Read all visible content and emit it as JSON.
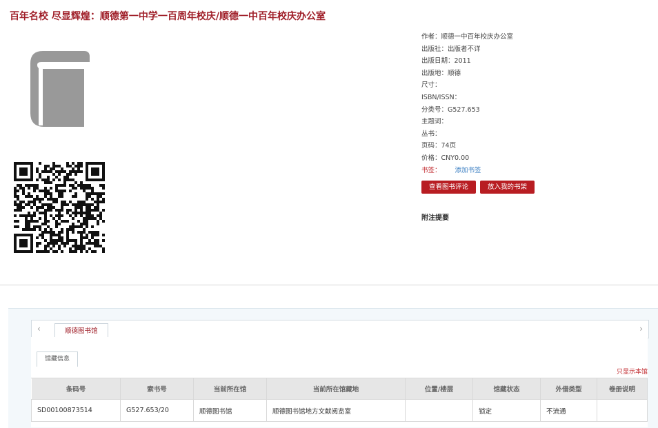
{
  "book_title": "百年名校 尽显辉煌：顺德第一中学一百周年校庆/顺德一中百年校庆办公室",
  "meta": [
    {
      "label": "作者：",
      "value": "顺德一中百年校庆办公室"
    },
    {
      "label": "出版社：",
      "value": "出版者不详"
    },
    {
      "label": "出版日期：",
      "value": "2011"
    },
    {
      "label": "出版地：",
      "value": "顺德"
    },
    {
      "label": "尺寸：",
      "value": ""
    },
    {
      "label": "ISBN/ISSN：",
      "value": ""
    },
    {
      "label": "分类号：",
      "value": "G527.653"
    },
    {
      "label": "主题词：",
      "value": ""
    },
    {
      "label": "丛书：",
      "value": ""
    },
    {
      "label": "页码：",
      "value": "74页"
    },
    {
      "label": "价格：",
      "value": "CNY0.00"
    }
  ],
  "bookmark": {
    "label": "书签：",
    "link": "添加书签"
  },
  "buttons": {
    "review": "查看图书评论",
    "shelf": "放入我的书架"
  },
  "notes_label": "附注提要",
  "library_tab": "顺德图书馆",
  "holdings_tab": "馆藏信息",
  "only_this_lib": "只显示本馆",
  "table": {
    "headers": [
      "条码号",
      "索书号",
      "当前所在馆",
      "当前所在馆藏地",
      "位置/楼层",
      "馆藏状态",
      "外借类型",
      "卷册说明"
    ],
    "rows": [
      [
        "SD00100873514",
        "G527.653/20",
        "顺德图书馆",
        "顺德图书馆地方文献阅览室",
        "",
        "锁定",
        "不流通",
        ""
      ]
    ]
  },
  "colors": {
    "accent": "#a0202a",
    "button": "#b81d22",
    "link": "#3a7ec2"
  },
  "icons": {
    "cover": "book-icon",
    "qr": "qr-code",
    "nav_left": "chevron-left-icon",
    "nav_right": "chevron-right-icon"
  }
}
